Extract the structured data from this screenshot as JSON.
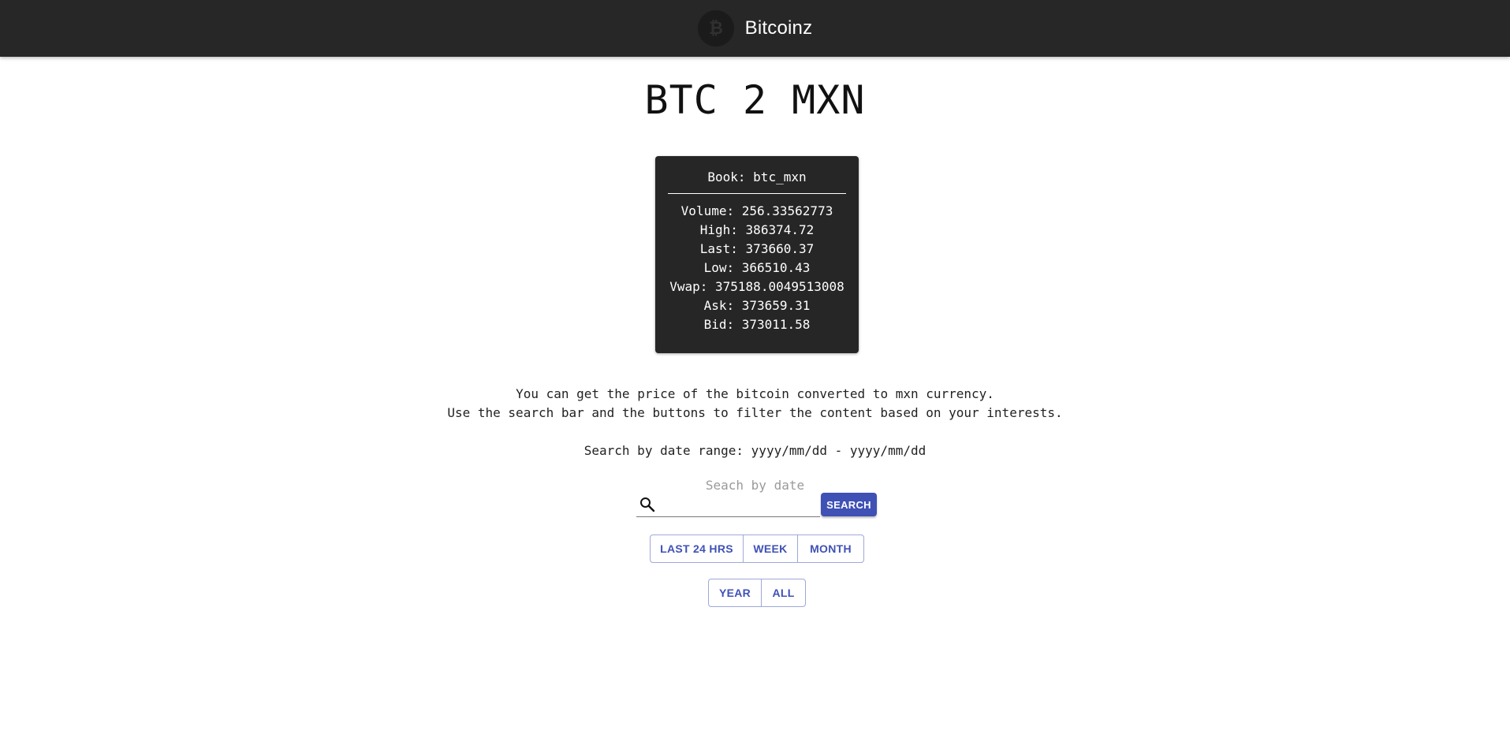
{
  "header": {
    "app_name": "Bitcoinz",
    "logo_icon": "bitcoin-icon"
  },
  "page": {
    "title": "BTC 2 MXN"
  },
  "book": {
    "book_line": "Book: btc_mxn",
    "rows": [
      "Volume: 256.33562773",
      "High: 386374.72",
      "Last: 373660.37",
      "Low: 366510.43",
      "Vwap: 375188.0049513008",
      "Ask: 373659.31",
      "Bid: 373011.58"
    ]
  },
  "description": {
    "line1": "You can get the price of the bitcoin converted to mxn currency.",
    "line2": "Use the search bar and the buttons to filter the content based on your interests.",
    "range_hint": "Search by date range: yyyy/mm/dd - yyyy/mm/dd"
  },
  "search": {
    "label": "Seach by date",
    "value": "",
    "button_label": "SEARCH",
    "icon": "search-icon"
  },
  "filters": {
    "group1": [
      "LAST 24 HRS",
      "WEEK",
      "MONTH"
    ],
    "group2": [
      "YEAR",
      "ALL"
    ]
  },
  "colors": {
    "appbar": "#272727",
    "card": "#262626",
    "primary": "#3f51b5"
  }
}
